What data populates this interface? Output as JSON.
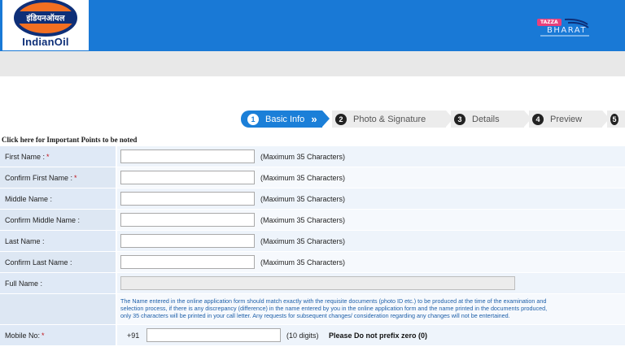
{
  "header": {
    "logo_text": "IndianOil",
    "logo_hindi": "इंडियनऑयल",
    "brand_tag": "TAZZA",
    "brand_name": "BHARAT"
  },
  "stepper": [
    {
      "num": "1",
      "label": "Basic Info",
      "active": true,
      "chevron": "»"
    },
    {
      "num": "2",
      "label": "Photo & Signature",
      "active": false
    },
    {
      "num": "3",
      "label": "Details",
      "active": false
    },
    {
      "num": "4",
      "label": "Preview",
      "active": false
    },
    {
      "num": "5",
      "label": "",
      "active": false
    }
  ],
  "important_link": "Click here for Important Points to be noted",
  "form": {
    "first_name": {
      "label": "First Name :",
      "required": "*",
      "value": "",
      "hint": "(Maximum 35 Characters)"
    },
    "confirm_first_name": {
      "label": "Confirm First Name :",
      "required": "*",
      "value": "",
      "hint": "(Maximum 35 Characters)"
    },
    "middle_name": {
      "label": "Middle Name :",
      "value": "",
      "hint": "(Maximum 35 Characters)"
    },
    "confirm_middle_name": {
      "label": "Confirm Middle Name :",
      "value": "",
      "hint": "(Maximum 35 Characters)"
    },
    "last_name": {
      "label": "Last Name :",
      "value": "",
      "hint": "(Maximum 35 Characters)"
    },
    "confirm_last_name": {
      "label": "Confirm Last Name :",
      "value": "",
      "hint": "(Maximum 35 Characters)"
    },
    "full_name": {
      "label": "Full Name :",
      "value": ""
    },
    "note_lines": [
      "The Name entered in the online application form should match exactly with the requisite documents (photo ID etc.) to be produced at the time of the examination and",
      "selection process, if there is any discrepancy (difference) in the name entered by you in the online application form and the name printed in the documents produced,",
      "only 35 characters will be printed in your call letter. Any requests for subsequent changes/ consideration regarding any changes will not be entertained."
    ],
    "mobile": {
      "label": "Mobile No:",
      "required": "*",
      "prefix": "+91",
      "value": "",
      "digits_hint": "(10 digits)",
      "warning": "Please Do not prefix zero (0)"
    }
  },
  "colors": {
    "header_blue": "#1979d6",
    "step_active": "#1b7fd8",
    "label_bg": "#dfe9f6",
    "note_text": "#1d5fa9",
    "required": "#c0141b"
  }
}
